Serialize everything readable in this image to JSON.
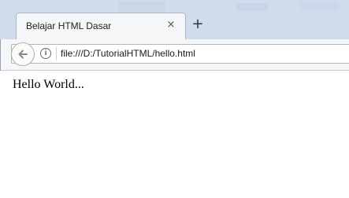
{
  "browser": {
    "tab": {
      "title": "Belajar HTML Dasar",
      "close_icon": "×"
    },
    "new_tab_icon": "+",
    "address_bar": {
      "url": "file:///D:/TutorialHTML/hello.html",
      "info_icon": "i"
    }
  },
  "page": {
    "body_text": "Hello World..."
  },
  "colors": {
    "titlebar": "#cfdcec",
    "toolbar": "#f5f6f7",
    "content_bg": "#ffffff"
  }
}
